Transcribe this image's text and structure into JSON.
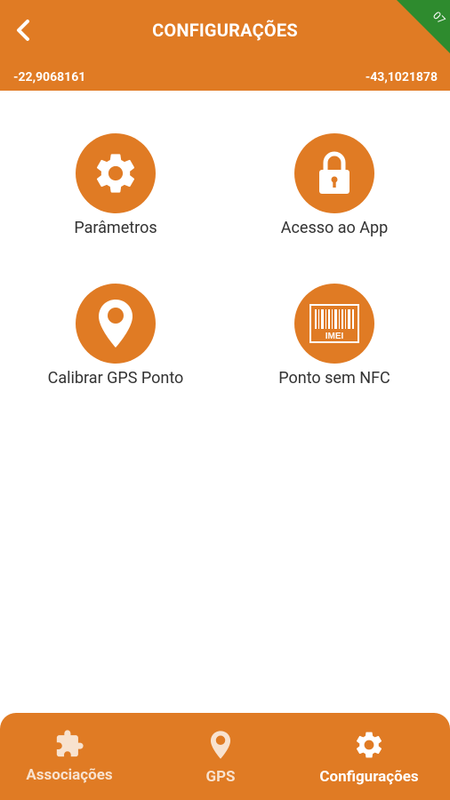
{
  "header": {
    "title": "CONFIGURAÇÕES",
    "latitude": "-22,9068161",
    "longitude": "-43,1021878",
    "corner_badge": "07"
  },
  "tiles": [
    {
      "label": "Parâmetros",
      "icon": "gear-icon"
    },
    {
      "label": "Acesso ao App",
      "icon": "lock-icon"
    },
    {
      "label": "Calibrar GPS Ponto",
      "icon": "location-pin-icon"
    },
    {
      "label": "Ponto sem NFC",
      "icon": "barcode-imei-icon"
    }
  ],
  "barcode_text": "IMEI",
  "bottom_nav": {
    "items": [
      {
        "label": "Associações",
        "icon": "puzzle-icon",
        "active": false
      },
      {
        "label": "GPS",
        "icon": "location-pin-icon",
        "active": false
      },
      {
        "label": "Configurações",
        "icon": "gear-icon",
        "active": true
      }
    ]
  },
  "colors": {
    "brand_orange": "#e07b24",
    "badge_green": "#2e8b2e",
    "text_dark": "#333333",
    "white": "#ffffff"
  }
}
